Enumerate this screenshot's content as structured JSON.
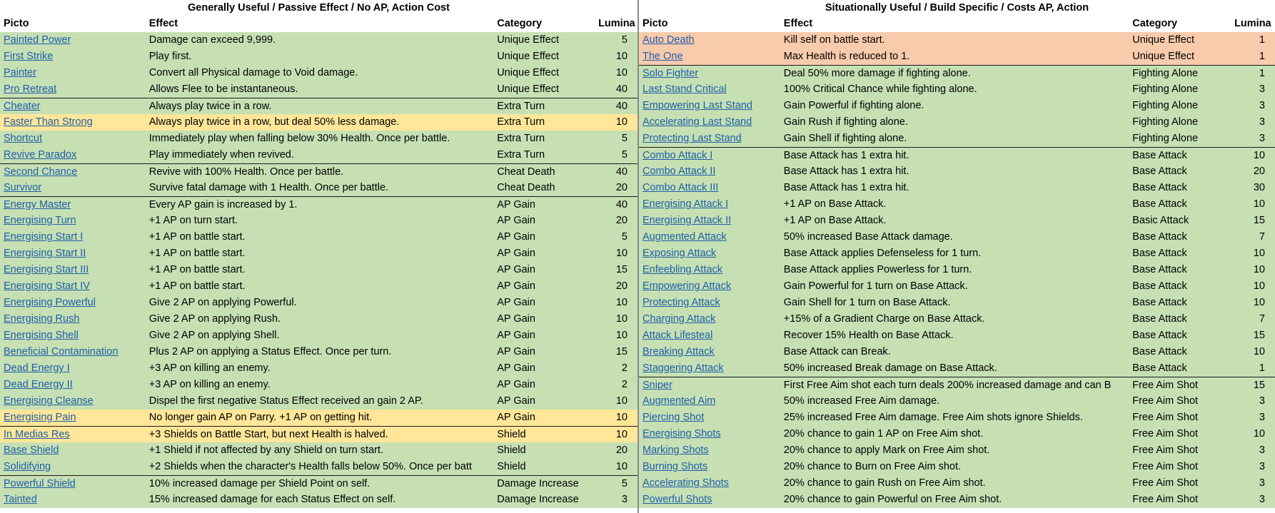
{
  "columns": {
    "picto": "Picto",
    "effect": "Effect",
    "category": "Category",
    "lumina": "Lumina"
  },
  "left": {
    "title": "Generally Useful / Passive Effect / No AP, Action Cost",
    "rows": [
      {
        "picto": "Painted Power",
        "effect": "Damage can exceed 9,999.",
        "category": "Unique Effect",
        "lumina": "5",
        "color": "green",
        "sep": false
      },
      {
        "picto": "First Strike",
        "effect": "Play first.",
        "category": "Unique Effect",
        "lumina": "10",
        "color": "green",
        "sep": false
      },
      {
        "picto": "Painter",
        "effect": "Convert all Physical damage to Void damage.",
        "category": "Unique Effect",
        "lumina": "10",
        "color": "green",
        "sep": false
      },
      {
        "picto": "Pro Retreat",
        "effect": "Allows Flee to be instantaneous.",
        "category": "Unique Effect",
        "lumina": "40",
        "color": "green",
        "sep": false
      },
      {
        "picto": "Cheater",
        "effect": "Always play twice in a row.",
        "category": "Extra Turn",
        "lumina": "40",
        "color": "green",
        "sep": true
      },
      {
        "picto": "Faster Than Strong",
        "effect": "Always play twice in a row, but deal 50% less damage.",
        "category": "Extra Turn",
        "lumina": "10",
        "color": "yellow",
        "sep": false
      },
      {
        "picto": "Shortcut",
        "effect": "Immediately play when falling below 30% Health. Once per battle.",
        "category": "Extra Turn",
        "lumina": "5",
        "color": "green",
        "sep": false
      },
      {
        "picto": "Revive Paradox",
        "effect": "Play immediately when revived.",
        "category": "Extra Turn",
        "lumina": "5",
        "color": "green",
        "sep": false
      },
      {
        "picto": "Second Chance",
        "effect": "Revive with 100% Health. Once per battle.",
        "category": "Cheat Death",
        "lumina": "40",
        "color": "green",
        "sep": true
      },
      {
        "picto": "Survivor",
        "effect": "Survive fatal damage with 1 Health. Once per battle.",
        "category": "Cheat Death",
        "lumina": "20",
        "color": "green",
        "sep": false
      },
      {
        "picto": "Energy Master",
        "effect": "Every AP gain is increased by 1.",
        "category": "AP Gain",
        "lumina": "40",
        "color": "green",
        "sep": true
      },
      {
        "picto": "Energising Turn",
        "effect": "+1 AP on turn start.",
        "category": "AP Gain",
        "lumina": "20",
        "color": "green",
        "sep": false
      },
      {
        "picto": "Energising Start I",
        "effect": "+1 AP on battle start.",
        "category": "AP Gain",
        "lumina": "5",
        "color": "green",
        "sep": false
      },
      {
        "picto": "Energising Start II",
        "effect": "+1 AP on battle start.",
        "category": "AP Gain",
        "lumina": "10",
        "color": "green",
        "sep": false
      },
      {
        "picto": "Energising Start III",
        "effect": "+1 AP on battle start.",
        "category": "AP Gain",
        "lumina": "15",
        "color": "green",
        "sep": false
      },
      {
        "picto": "Energising Start IV",
        "effect": "+1 AP on battle start.",
        "category": "AP Gain",
        "lumina": "20",
        "color": "green",
        "sep": false
      },
      {
        "picto": "Energising Powerful",
        "effect": "Give 2 AP on applying Powerful.",
        "category": "AP Gain",
        "lumina": "10",
        "color": "green",
        "sep": false
      },
      {
        "picto": "Energising Rush",
        "effect": "Give 2 AP on applying Rush.",
        "category": "AP Gain",
        "lumina": "10",
        "color": "green",
        "sep": false
      },
      {
        "picto": "Energising Shell",
        "effect": "Give 2 AP on applying Shell.",
        "category": "AP Gain",
        "lumina": "10",
        "color": "green",
        "sep": false
      },
      {
        "picto": "Beneficial Contamination",
        "effect": "Plus 2 AP on applying a Status Effect. Once per turn.",
        "category": "AP Gain",
        "lumina": "15",
        "color": "green",
        "sep": false
      },
      {
        "picto": "Dead Energy I",
        "effect": "+3 AP on killing an enemy.",
        "category": "AP Gain",
        "lumina": "2",
        "color": "green",
        "sep": false
      },
      {
        "picto": "Dead Energy II",
        "effect": "+3 AP on killing an enemy.",
        "category": "AP Gain",
        "lumina": "2",
        "color": "green",
        "sep": false
      },
      {
        "picto": "Energising Cleanse",
        "effect": "Dispel the first negative Status Effect received an gain 2 AP.",
        "category": "AP Gain",
        "lumina": "10",
        "color": "green",
        "sep": false
      },
      {
        "picto": "Energising Pain",
        "effect": "No longer gain AP on Parry. +1 AP on getting hit.",
        "category": "AP Gain",
        "lumina": "10",
        "color": "yellow",
        "sep": false
      },
      {
        "picto": "In Medias Res",
        "effect": "+3 Shields on Battle Start, but next Health is halved.",
        "category": "Shield",
        "lumina": "10",
        "color": "yellow",
        "sep": true
      },
      {
        "picto": "Base Shield",
        "effect": "+1 Shield if not affected by any Shield on turn start.",
        "category": "Shield",
        "lumina": "20",
        "color": "green",
        "sep": false
      },
      {
        "picto": "Solidifying",
        "effect": "+2 Shields when the character's Health falls below 50%. Once per batt",
        "category": "Shield",
        "lumina": "10",
        "color": "green",
        "sep": false
      },
      {
        "picto": "Powerful Shield",
        "effect": "10% increased damage per Shield Point on self.",
        "category": "Damage Increase",
        "lumina": "5",
        "color": "green",
        "sep": true
      },
      {
        "picto": "Tainted",
        "effect": "15% increased damage for each Status Effect on self.",
        "category": "Damage Increase",
        "lumina": "3",
        "color": "green",
        "sep": false
      }
    ]
  },
  "right": {
    "title": "Situationally Useful / Build Specific / Costs AP, Action",
    "rows": [
      {
        "picto": "Auto Death",
        "effect": "Kill self on battle start.",
        "category": "Unique Effect",
        "lumina": "1",
        "color": "orange",
        "sep": false
      },
      {
        "picto": "The One",
        "effect": "Max Health is reduced to 1.",
        "category": "Unique Effect",
        "lumina": "1",
        "color": "orange",
        "sep": false
      },
      {
        "picto": "Solo Fighter",
        "effect": "Deal 50% more damage if fighting alone.",
        "category": "Fighting Alone",
        "lumina": "1",
        "color": "green",
        "sep": true
      },
      {
        "picto": "Last Stand Critical",
        "effect": "100% Critical Chance while fighting alone.",
        "category": "Fighting Alone",
        "lumina": "3",
        "color": "green",
        "sep": false
      },
      {
        "picto": "Empowering Last Stand",
        "effect": "Gain Powerful if fighting alone.",
        "category": "Fighting Alone",
        "lumina": "3",
        "color": "green",
        "sep": false
      },
      {
        "picto": "Accelerating Last Stand",
        "effect": "Gain Rush if fighting alone.",
        "category": "Fighting Alone",
        "lumina": "3",
        "color": "green",
        "sep": false
      },
      {
        "picto": "Protecting Last Stand",
        "effect": "Gain Shell if fighting alone.",
        "category": "Fighting Alone",
        "lumina": "3",
        "color": "green",
        "sep": false
      },
      {
        "picto": "Combo Attack I",
        "effect": "Base Attack has 1 extra hit.",
        "category": "Base Attack",
        "lumina": "10",
        "color": "green",
        "sep": true
      },
      {
        "picto": "Combo Attack II",
        "effect": "Base Attack has 1 extra hit.",
        "category": "Base Attack",
        "lumina": "20",
        "color": "green",
        "sep": false
      },
      {
        "picto": "Combo Attack III",
        "effect": "Base Attack has 1 extra hit.",
        "category": "Base Attack",
        "lumina": "30",
        "color": "green",
        "sep": false
      },
      {
        "picto": "Energising Attack I",
        "effect": "+1 AP on Base Attack.",
        "category": "Base Attack",
        "lumina": "10",
        "color": "green",
        "sep": false
      },
      {
        "picto": "Energising Attack II",
        "effect": "+1 AP on Base Attack.",
        "category": "Basic Attack",
        "lumina": "15",
        "color": "green",
        "sep": false
      },
      {
        "picto": "Augmented Attack",
        "effect": "50% increased Base Attack damage.",
        "category": "Base Attack",
        "lumina": "7",
        "color": "green",
        "sep": false
      },
      {
        "picto": "Exposing Attack",
        "effect": "Base Attack applies Defenseless for 1 turn.",
        "category": "Base Attack",
        "lumina": "10",
        "color": "green",
        "sep": false
      },
      {
        "picto": "Enfeebling Attack",
        "effect": "Base Attack applies Powerless for 1 turn.",
        "category": "Base Attack",
        "lumina": "10",
        "color": "green",
        "sep": false
      },
      {
        "picto": "Empowering Attack",
        "effect": "Gain Powerful for 1 turn on Base Attack.",
        "category": "Base Attack",
        "lumina": "10",
        "color": "green",
        "sep": false
      },
      {
        "picto": "Protecting Attack",
        "effect": "Gain Shell for 1 turn on Base Attack.",
        "category": "Base Attack",
        "lumina": "10",
        "color": "green",
        "sep": false
      },
      {
        "picto": "Charging Attack",
        "effect": "+15% of a Gradient Charge on Base Attack.",
        "category": "Base Attack",
        "lumina": "7",
        "color": "green",
        "sep": false
      },
      {
        "picto": "Attack Lifesteal",
        "effect": "Recover 15% Health on Base Attack.",
        "category": "Base Attack",
        "lumina": "15",
        "color": "green",
        "sep": false
      },
      {
        "picto": "Breaking Attack",
        "effect": "Base Attack can Break.",
        "category": "Base Attack",
        "lumina": "10",
        "color": "green",
        "sep": false
      },
      {
        "picto": "Staggering Attack",
        "effect": "50% increased Break damage on Base Attack.",
        "category": "Base Attack",
        "lumina": "1",
        "color": "green",
        "sep": false
      },
      {
        "picto": "Sniper",
        "effect": "First Free Aim shot each turn deals 200% increased damage and can B",
        "category": "Free Aim Shot",
        "lumina": "15",
        "color": "green",
        "sep": true
      },
      {
        "picto": "Augmented Aim",
        "effect": "50% increased Free Aim damage.",
        "category": "Free Aim Shot",
        "lumina": "3",
        "color": "green",
        "sep": false
      },
      {
        "picto": "Piercing Shot",
        "effect": "25% increased Free Aim damage. Free Aim shots ignore Shields.",
        "category": "Free Aim Shot",
        "lumina": "3",
        "color": "green",
        "sep": false
      },
      {
        "picto": "Energising Shots",
        "effect": "20% chance to gain 1 AP on Free Aim shot.",
        "category": "Free Aim Shot",
        "lumina": "10",
        "color": "green",
        "sep": false
      },
      {
        "picto": "Marking Shots",
        "effect": "20% chance to apply Mark on Free Aim shot.",
        "category": "Free Aim Shot",
        "lumina": "3",
        "color": "green",
        "sep": false
      },
      {
        "picto": "Burning Shots",
        "effect": "20% chance to Burn on Free Aim shot.",
        "category": "Free Aim Shot",
        "lumina": "3",
        "color": "green",
        "sep": false
      },
      {
        "picto": "Accelerating Shots",
        "effect": "20% chance to gain Rush on Free Aim shot.",
        "category": "Free Aim Shot",
        "lumina": "3",
        "color": "green",
        "sep": false
      },
      {
        "picto": "Powerful Shots",
        "effect": "20% chance to gain Powerful on Free Aim shot.",
        "category": "Free Aim Shot",
        "lumina": "3",
        "color": "green",
        "sep": false
      }
    ]
  },
  "colors": {
    "green": "#c6e0b4",
    "yellow": "#ffe699",
    "orange": "#f8cbad",
    "link": "#1f5ea8"
  }
}
